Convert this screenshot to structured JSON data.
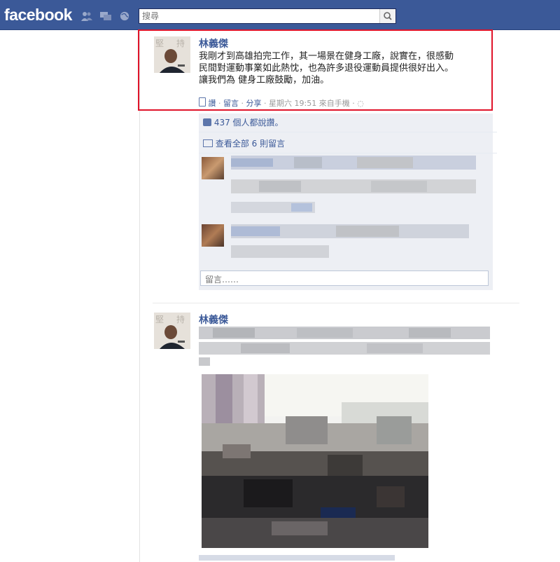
{
  "topbar": {
    "logo": "facebook",
    "search_placeholder": "搜尋",
    "icons": [
      "friends-icon",
      "messages-icon",
      "notifications-globe-icon"
    ],
    "brand_color": "#3b5998"
  },
  "post1": {
    "author": "林義傑",
    "message_lines": [
      "我剛才到高雄拍完工作，其一場景在健身工廠，說實在，很感動",
      "民間對運動事業如此熱忱，也為許多退役運動員提供很好出入。",
      "讓我們為 健身工廠鼓勵，加油。"
    ],
    "meta": {
      "like": "讚",
      "comment": "留言",
      "share": "分享",
      "time": "星期六 19:51 來自手機"
    },
    "likes_text": "437 個人都說讚。",
    "view_comments": "查看全部 6 則留言",
    "comment_placeholder": "留言……",
    "highlight_color": "#e0142a"
  },
  "post2": {
    "author": "林義傑"
  }
}
